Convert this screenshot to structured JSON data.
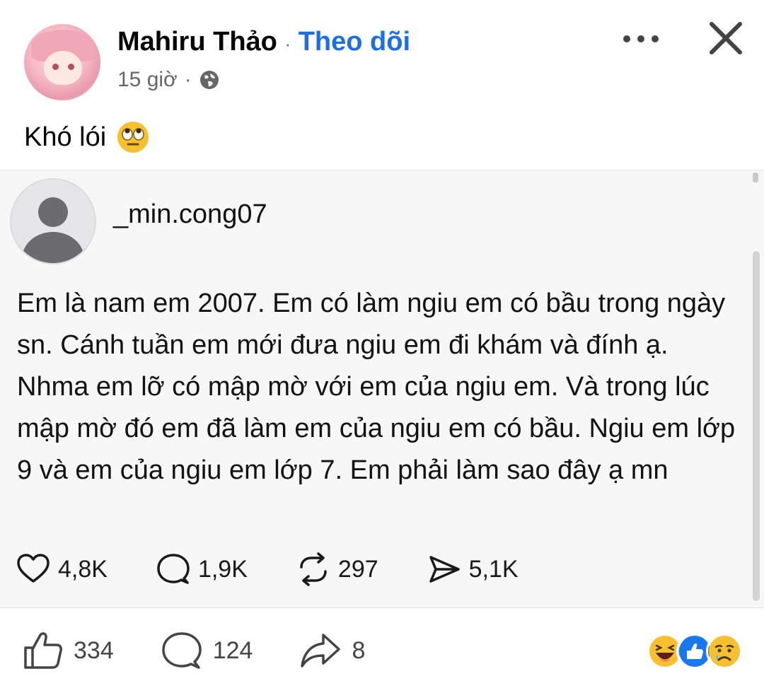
{
  "header": {
    "author_name": "Mahiru Thảo",
    "separator": "·",
    "follow_label": "Theo dõi",
    "time": "15 giờ",
    "time_separator": "·"
  },
  "caption": "Khó lói",
  "shared_post": {
    "username": "_min.cong07",
    "text": "Em là nam em 2007. Em có làm ngiu em có bầu trong ngày sn. Cánh tuần em mới đưa ngiu em đi khám và đính ạ. Nhma em lỡ có mập mờ với em của ngiu em. Và trong lúc mập mờ đó em đã làm em của ngiu em có bầu. Ngiu em lớp 9 và em của ngiu em lớp 7. Em phải làm sao đây ạ mn",
    "likes": "4,8K",
    "replies": "1,9K",
    "reposts": "297",
    "shares": "5,1K"
  },
  "footer": {
    "like_count": "334",
    "comment_count": "124",
    "share_count": "8",
    "reactions": [
      "haha-icon",
      "like-icon",
      "sad-icon"
    ]
  },
  "colors": {
    "follow": "#1b6fe3",
    "meta": "#65676b",
    "card_bg": "#f7f7f8",
    "like_reaction": "#1877f2",
    "haha_reaction": "#f7c02e"
  }
}
